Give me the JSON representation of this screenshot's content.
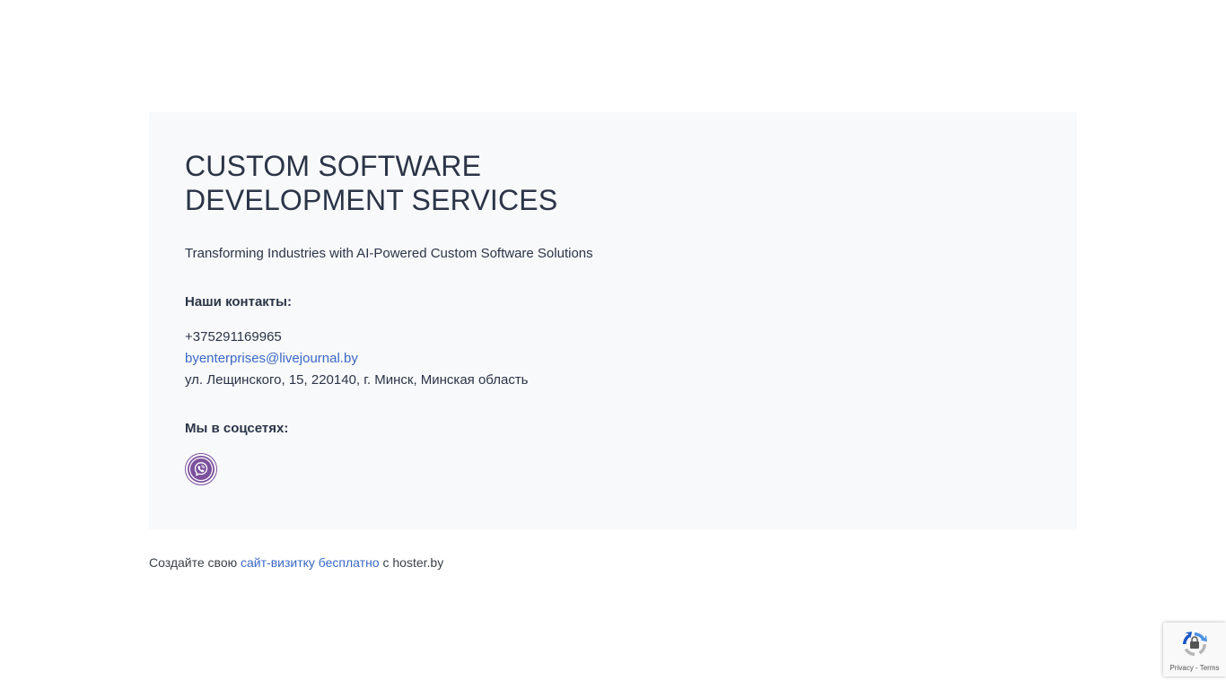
{
  "hero": {
    "title": "CUSTOM SOFTWARE DEVELOPMENT SERVICES",
    "subtitle": "Transforming Industries with AI-Powered Custom Software Solutions"
  },
  "contacts": {
    "heading": "Наши контакты:",
    "phone": "+375291169965",
    "email": "byenterprises@livejournal.by",
    "address": "ул. Лещинского, 15, 220140, г. Минск, Минская область"
  },
  "social": {
    "heading": "Мы в соцсетях:",
    "items": [
      {
        "icon": "viber-icon",
        "color": "#7b519d"
      }
    ]
  },
  "footer": {
    "prefix": "Создайте свою",
    "link_label": "сайт-визитку бесплатно",
    "suffix": "с hoster.by"
  },
  "recaptcha": {
    "links": "Privacy - Terms"
  },
  "colors": {
    "card_background": "#f8f9fa",
    "text": "#2b3447",
    "link": "#3a68c5",
    "viber": "#7b519d"
  }
}
